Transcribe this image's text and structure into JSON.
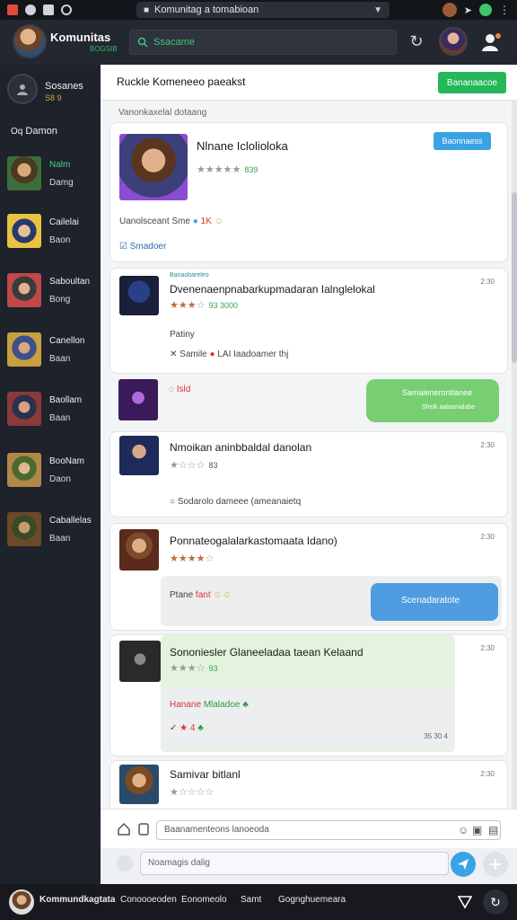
{
  "status": {
    "url": "Komunitag a tomabioan"
  },
  "topbar": {
    "app_title": "Komunitas",
    "app_sub": "BOGSIB",
    "search_value": "Ssacame"
  },
  "sidebar": {
    "header_title": "Sosanes",
    "header_sub": "S8 9",
    "section_label": "Damon",
    "contacts": [
      {
        "name": "Nalm",
        "status": "Damg"
      },
      {
        "name": "Cailelai",
        "status": "Baon"
      },
      {
        "name": "Saboultan",
        "status": "Bong"
      },
      {
        "name": "Canellon",
        "status": "Baan"
      },
      {
        "name": "Baollam",
        "status": "Baan"
      },
      {
        "name": "BooNam",
        "status": "Daon"
      },
      {
        "name": "Caballelas",
        "status": "Baan"
      }
    ]
  },
  "main": {
    "title": "Ruckle Komeneeo paeakst",
    "header_button": "Bananaacoe",
    "filter_label": "Vanonkaxelal dotaang",
    "featured": {
      "title": "Nlnane Iclolioloka",
      "rating_count": "839",
      "pill": "Baonnaess",
      "meta_text": "Uanolsceant Sme",
      "meta_count": "1K",
      "link_text": "Smadoer"
    },
    "posts": [
      {
        "tag": "Banaobareleo",
        "title": "Dvenenaenpnabarkupmadaran Ialnglelokal",
        "rating_count": "93 3000",
        "time": "2:30",
        "sub_label": "Patiny",
        "sub_line_prefix": "Samile",
        "sub_line": "LAI Iaadoamer thj"
      },
      {
        "title_line": "Isld",
        "bubble": "Samalenerontlanee",
        "bubble_sub": "Shelk aalsamalabe"
      },
      {
        "title": "Nmoikan aninbbaldal danolan",
        "rating_count": "83",
        "time": "2:30",
        "footer": "Sodarolo dameee (ameanaietq"
      },
      {
        "title": "Ponnateogalalarkastomaata Idano)",
        "time": "2:30",
        "grey_text": "Ptane",
        "grey_accent": "fant",
        "bubble": "Scenadaratote"
      },
      {
        "title": "Sononiesler Glaneeladaa taean Kelaand",
        "rating_count": "93",
        "time": "2:30",
        "inner_text": "Hanane",
        "inner_accent": "Mlaladoe",
        "inner_meta": "4",
        "inner_stamp": "35 30 4"
      },
      {
        "title": "Samivar bitlanl",
        "time": "2:30"
      }
    ]
  },
  "compose": {
    "placeholder1": "Baanamenteons lanoeoda",
    "placeholder2": "Noamagis dalig"
  },
  "bottomnav": {
    "items": [
      "Kommundkagtata",
      "Conoooeoden",
      "Eonomeolo",
      "Samt",
      "Gognghuemeara"
    ]
  },
  "colors": {
    "accent_green": "#24b85a",
    "accent_blue": "#3aa3e4",
    "sidebar_bg": "#1e222a"
  }
}
